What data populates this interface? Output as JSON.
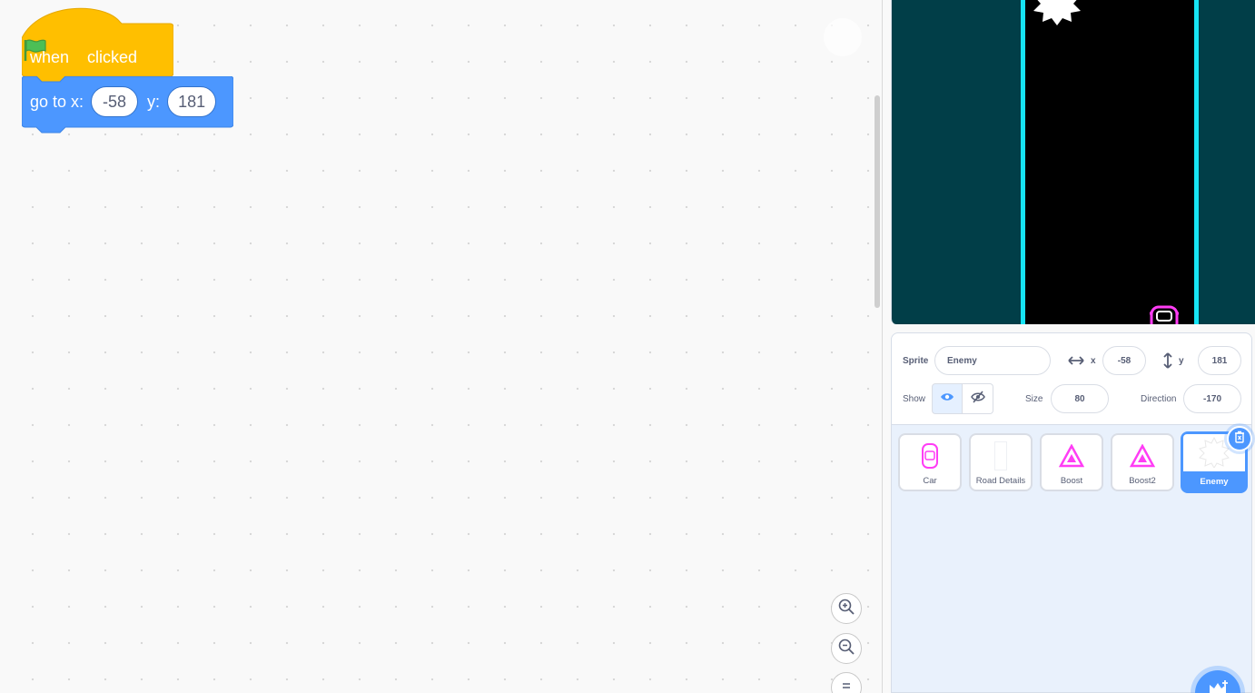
{
  "blocks": {
    "hat": {
      "when": "when",
      "clicked": "clicked"
    },
    "go_to": {
      "label": "go to x:",
      "x_value": "-58",
      "y_label": "y:",
      "y_value": "181"
    }
  },
  "sprite_info": {
    "sprite_label": "Sprite",
    "sprite_name": "Enemy",
    "x_label": "x",
    "x_value": "-58",
    "y_label": "y",
    "y_value": "181",
    "show_label": "Show",
    "size_label": "Size",
    "size_value": "80",
    "direction_label": "Direction",
    "direction_value": "-170"
  },
  "sprites": [
    {
      "name": "Car"
    },
    {
      "name": "Road Details"
    },
    {
      "name": "Boost"
    },
    {
      "name": "Boost2"
    },
    {
      "name": "Enemy"
    }
  ],
  "colors": {
    "events": "#ffbf00",
    "motion": "#4c97ff",
    "accent": "#4c97ff",
    "road_line": "#16e4f4",
    "stage_bg": "#013e48",
    "neon_pink": "#ff3df5"
  },
  "icons": [
    "green-flag-icon",
    "zoom-in-icon",
    "zoom-out-icon",
    "zoom-reset-icon",
    "eye-icon",
    "eye-hidden-icon",
    "x-arrows-icon",
    "y-arrows-icon",
    "trash-icon",
    "add-sprite-icon"
  ]
}
